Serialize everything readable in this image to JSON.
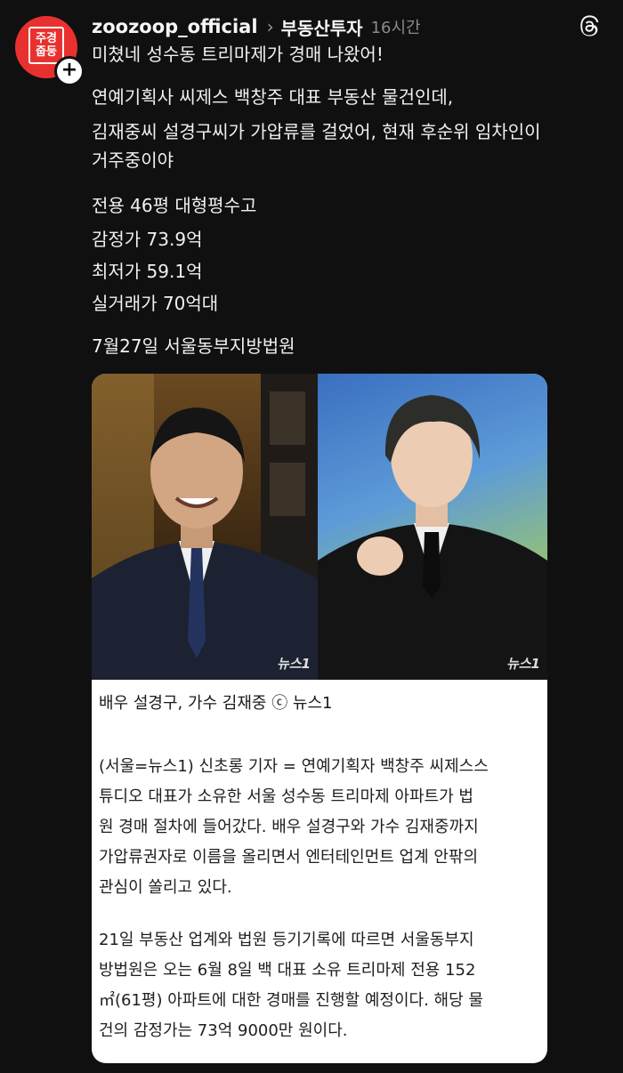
{
  "post": {
    "avatar_text_top": "주경",
    "avatar_text_bottom": "줍둥",
    "avatar_plus": "+",
    "username": "zoozoop_official",
    "chevron": "›",
    "category": "부동산투자",
    "time": "16시간",
    "app_icon": "threads-icon",
    "body_lines": [
      "미쳤네 성수동 트리마제가 경매 나왔어!",
      "연예기획사 씨제스 백창주 대표 부동산 물건인데,",
      "김재중씨 설경구씨가 가압류를 걸었어, 현재 후순위 임차인이",
      "거주중이야",
      "전용 46평 대형평수고",
      "감정가 73.9억",
      "최저가 59.1억",
      "실거래가 70억대",
      "7월27일 서울동부지방법원"
    ]
  },
  "card": {
    "watermark_left": "뉴스1",
    "watermark_right": "뉴스1",
    "caption": "배우 설경구, 가수 김재중 ⓒ 뉴스1",
    "article_lines": [
      "(서울=뉴스1) 신초롱 기자 = 연예기획자 백창주 씨제스스",
      "튜디오 대표가 소유한 서울 성수동 트리마제 아파트가 법",
      "원 경매 절차에 들어갔다. 배우 설경구와 가수 김재중까지",
      "가압류권자로 이름을 올리면서 엔터테인먼트 업계 안팎의",
      "관심이 쏠리고 있다.",
      "21일 부동산 업계와 법원 등기기록에 따르면 서울동부지",
      "방법원은 오는 6월 8일 백 대표 소유 트리마제 전용 152",
      "㎡(61평) 아파트에 대한 경매를 진행할 예정이다. 해당 물",
      "건의 감정가는 73억 9000만 원이다."
    ]
  },
  "colors": {
    "background": "#101010",
    "avatar": "#e8312f",
    "card": "#ffffff"
  }
}
